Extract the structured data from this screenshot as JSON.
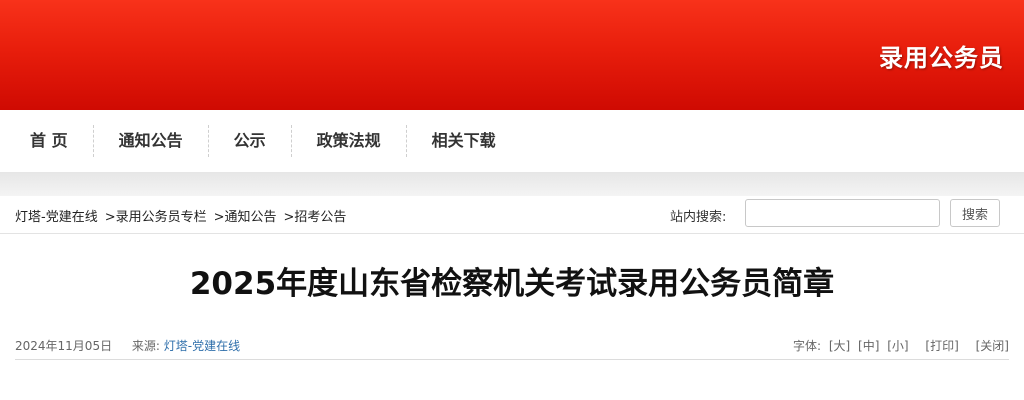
{
  "header": {
    "title": "录用公务员",
    "colors": {
      "banner_top": "#f8321a",
      "banner_bottom": "#cf0a02"
    }
  },
  "nav": {
    "items": [
      {
        "label": "首 页"
      },
      {
        "label": "通知公告"
      },
      {
        "label": "公示"
      },
      {
        "label": "政策法规"
      },
      {
        "label": "相关下载"
      }
    ]
  },
  "breadcrumb": {
    "items": [
      {
        "label": "灯塔-党建在线"
      },
      {
        "label": ">录用公务员专栏"
      },
      {
        "label": ">通知公告"
      },
      {
        "label": ">招考公告"
      }
    ]
  },
  "search": {
    "label": "站内搜索:",
    "value": "",
    "placeholder": "",
    "button_label": "搜索"
  },
  "article": {
    "title": "2025年度山东省检察机关考试录用公务员简章",
    "date": "2024年11月05日",
    "source_label": "来源:",
    "source": "灯塔-党建在线",
    "font_size_label": "字体:",
    "font_large": "[大]",
    "font_medium": "[中]",
    "font_small": "[小]",
    "print": "[打印]",
    "close": "[关闭]"
  }
}
